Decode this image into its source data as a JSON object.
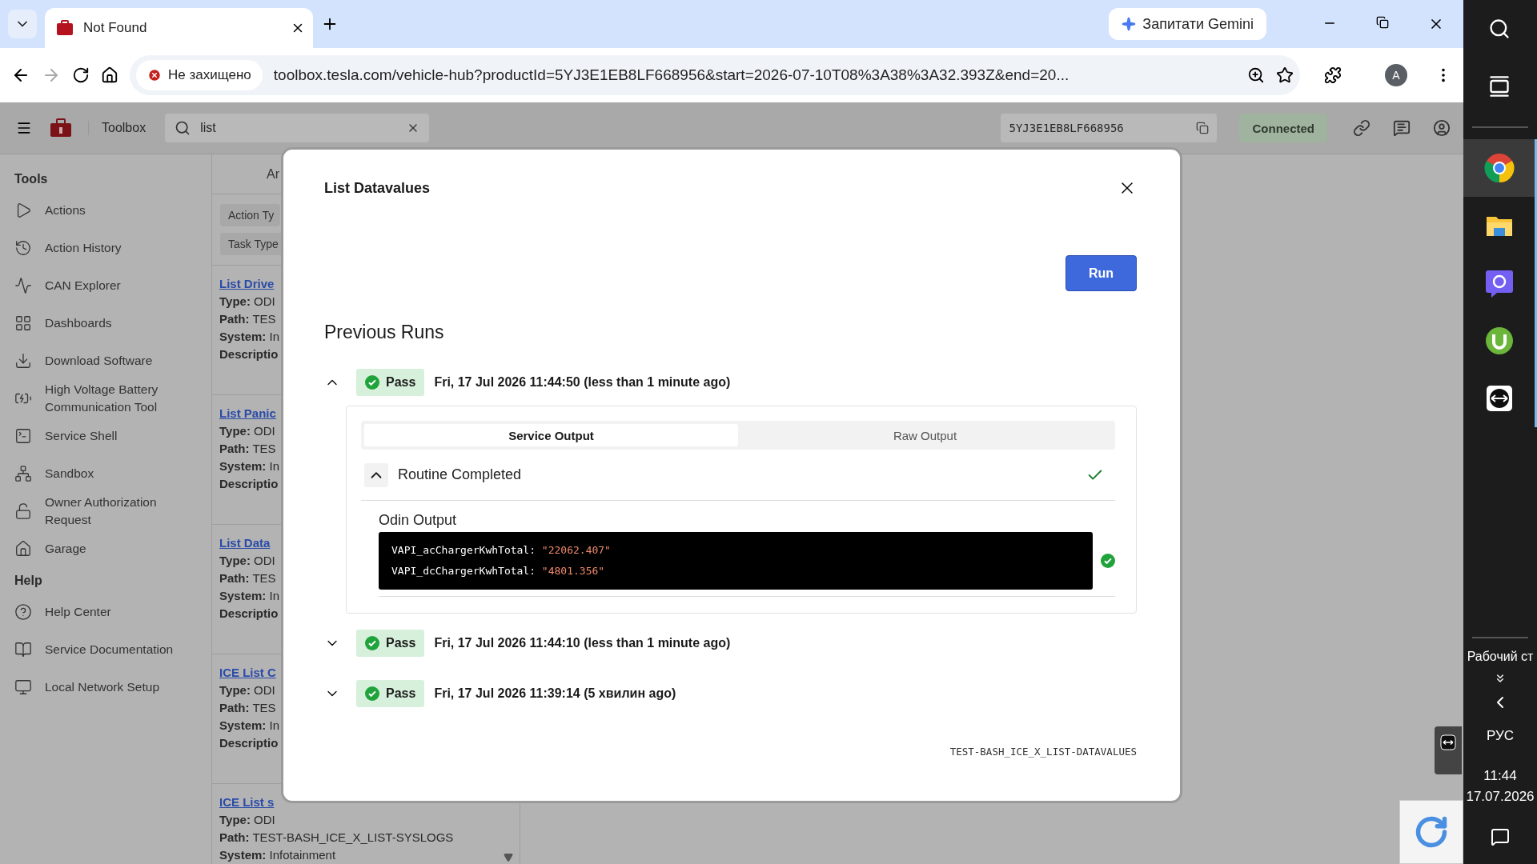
{
  "browser": {
    "tab": {
      "title": "Not Found"
    },
    "gemini_button": "Запитати Gemini",
    "security_chip": "Не захищено",
    "url": "toolbox.tesla.com/vehicle-hub?productId=5YJ3E1EB8LF668956&start=2026-07-10T08%3A38%3A32.393Z&end=20...",
    "avatar": "A"
  },
  "app": {
    "brand": "Toolbox",
    "search": {
      "value": "list"
    },
    "vin": "5YJ3E1EB8LF668956",
    "status": "Connected"
  },
  "sidebar": {
    "sections": [
      {
        "title": "Tools",
        "items": [
          {
            "label": "Actions"
          },
          {
            "label": "Action History"
          },
          {
            "label": "CAN Explorer"
          },
          {
            "label": "Dashboards"
          },
          {
            "label": "Download Software"
          },
          {
            "label": "High Voltage Battery Communication Tool"
          },
          {
            "label": "Service Shell"
          },
          {
            "label": "Sandbox"
          },
          {
            "label": "Owner Authorization Request"
          },
          {
            "label": "Garage"
          }
        ]
      },
      {
        "title": "Help",
        "items": [
          {
            "label": "Help Center"
          },
          {
            "label": "Service Documentation"
          },
          {
            "label": "Local Network Setup"
          }
        ]
      }
    ]
  },
  "list_column": {
    "header": "Ar",
    "filters": [
      "Action Ty",
      "Task Type"
    ],
    "items": [
      {
        "title": "List Drive",
        "lines": [
          {
            "label": "Type:",
            "value": " ODI"
          },
          {
            "label": "Path:",
            "value": " TES"
          },
          {
            "label": "System:",
            "value": " In"
          },
          {
            "label": "Descriptio"
          }
        ]
      },
      {
        "title": "List Panic",
        "lines": [
          {
            "label": "Type:",
            "value": " ODI"
          },
          {
            "label": "Path:",
            "value": " TES"
          },
          {
            "label": "System:",
            "value": " In"
          },
          {
            "label": "Descriptio"
          }
        ]
      },
      {
        "title": "List Data",
        "lines": [
          {
            "label": "Type:",
            "value": " ODI"
          },
          {
            "label": "Path:",
            "value": " TES"
          },
          {
            "label": "System:",
            "value": " In"
          },
          {
            "label": "Descriptio"
          }
        ]
      },
      {
        "title": "ICE List C",
        "lines": [
          {
            "label": "Type:",
            "value": " ODI"
          },
          {
            "label": "Path:",
            "value": " TES"
          },
          {
            "label": "System:",
            "value": " In"
          },
          {
            "label": "Descriptio"
          }
        ]
      },
      {
        "title": "ICE List s",
        "lines": [
          {
            "label": "Type:",
            "value": " ODI"
          },
          {
            "label": "Path:",
            "value": " TEST-BASH_ICE_X_LIST-SYSLOGS"
          },
          {
            "label": "System:",
            "value": " Infotainment"
          }
        ]
      }
    ]
  },
  "modal": {
    "title": "List Datavalues",
    "run_button": "Run",
    "section_title": "Previous Runs",
    "runs": [
      {
        "expanded": true,
        "kind": "pass",
        "status": "Pass",
        "timestamp": "Fri, 17 Jul 2026 11:44:50 (less than 1 minute ago)",
        "output": {
          "tabs": [
            {
              "label": "Service Output",
              "selected": true
            },
            {
              "label": "Raw Output",
              "selected": false
            }
          ],
          "routine": {
            "title": "Routine Completed",
            "expanded": true,
            "passed": true
          },
          "output_title": "Odin Output",
          "passed": true,
          "lines": [
            {
              "key": "VAPI_acChargerKwhTotal:",
              "value": "\"22062.407\""
            },
            {
              "key": "VAPI_dcChargerKwhTotal:",
              "value": "\"4801.356\""
            }
          ]
        }
      },
      {
        "expanded": false,
        "kind": "pass",
        "status": "Pass",
        "timestamp": "Fri, 17 Jul 2026 11:44:10 (less than 1 minute ago)"
      },
      {
        "expanded": false,
        "kind": "pass",
        "status": "Pass",
        "timestamp": "Fri, 17 Jul 2026 11:39:14 (5 хвилин ago)"
      }
    ],
    "footer": "TEST-BASH_ICE_X_LIST-DATAVALUES"
  },
  "taskbar": {
    "desktop_label": "Рабочий ст",
    "language": "РУС",
    "time": "11:44",
    "date": "17.07.2026"
  }
}
